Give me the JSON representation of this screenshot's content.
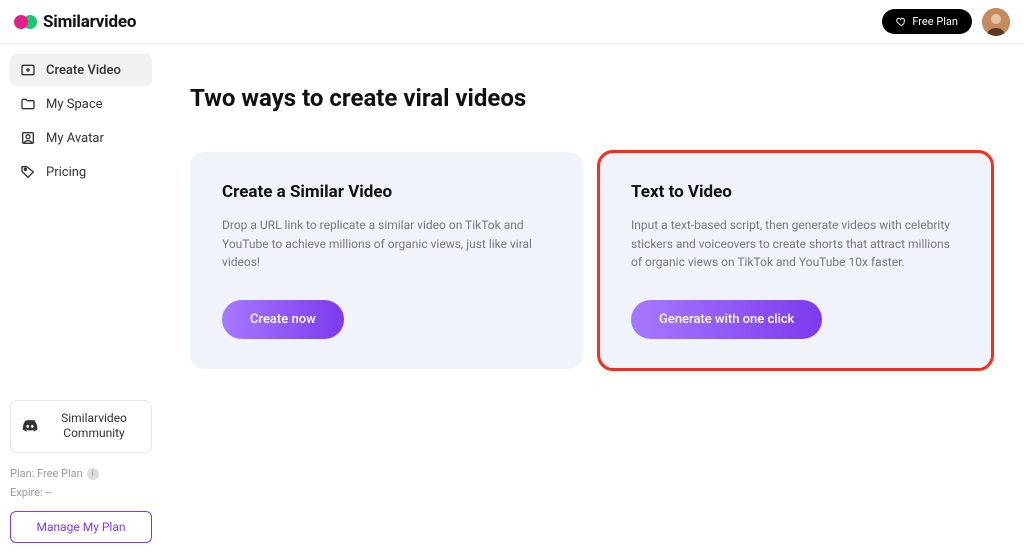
{
  "header": {
    "brand": "Similarvideo",
    "free_plan_btn": "Free Plan"
  },
  "sidebar": {
    "items": [
      {
        "label": "Create Video"
      },
      {
        "label": "My Space"
      },
      {
        "label": "My Avatar"
      },
      {
        "label": "Pricing"
      }
    ],
    "community_label": "Similarvideo Community",
    "plan_label": "Plan: Free Plan",
    "expire_label": "Expire: --",
    "manage_btn": "Manage My Plan"
  },
  "main": {
    "title": "Two ways to create viral videos",
    "cards": [
      {
        "title": "Create a Similar Video",
        "desc": "Drop a URL link to replicate a similar video on TikTok and YouTube to achieve millions of organic views, just like viral videos!",
        "cta": "Create now"
      },
      {
        "title": "Text to Video",
        "desc": "Input a text-based script, then generate videos with celebrity stickers and voiceovers to create shorts that attract millions of organic views on TikTok and YouTube 10x faster.",
        "cta": "Generate with one click"
      }
    ]
  }
}
